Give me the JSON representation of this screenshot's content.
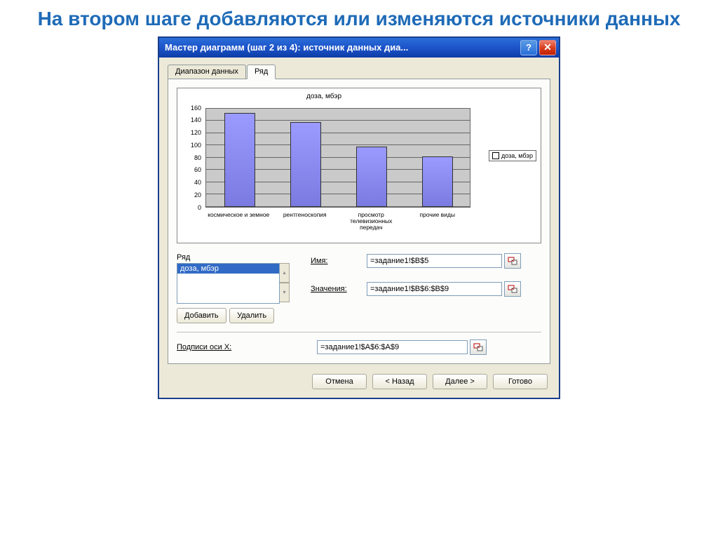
{
  "page_heading": "На втором шаге добавляются или изменяются источники данных",
  "titlebar": "Мастер диаграмм (шаг 2 из 4): источник данных диа...",
  "tabs": {
    "data_range": "Диапазон данных",
    "series": "Ряд"
  },
  "chart_data": {
    "type": "bar",
    "title": "доза, мбэр",
    "legend": "доза, мбэр",
    "ylim": [
      0,
      160
    ],
    "yticks": [
      0,
      20,
      40,
      60,
      80,
      100,
      120,
      140,
      160
    ],
    "categories": [
      "космическое и земное",
      "рентгеноскопия",
      "просмотр телевизионных передач",
      "прочие виды"
    ],
    "values": [
      150,
      135,
      95,
      80
    ]
  },
  "series_panel": {
    "label": "Ряд",
    "selected": "доза, мбэр",
    "name_label": "Имя:",
    "name_value": "=задание1!$B$5",
    "values_label": "Значения:",
    "values_value": "=задание1!$B$6:$B$9",
    "add_btn": "Добавить",
    "remove_btn": "Удалить"
  },
  "xaxis": {
    "label": "Подписи оси X:",
    "value": "=задание1!$A$6:$A$9"
  },
  "footer": {
    "cancel": "Отмена",
    "back": "< Назад",
    "next": "Далее >",
    "finish": "Готово"
  }
}
